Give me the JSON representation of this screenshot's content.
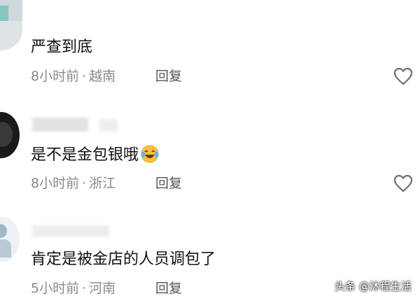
{
  "comments": [
    {
      "text": "严查到底",
      "time": "8小时前",
      "location": "越南",
      "reply": "回复"
    },
    {
      "text": "是不是金包银哦",
      "emoji": "laughing-tears-emoji",
      "time": "8小时前",
      "location": "浙江",
      "reply": "回复"
    },
    {
      "text": "肯定是被金店的人员调包了",
      "time": "5小时前",
      "location": "河南",
      "reply": "回复"
    }
  ],
  "separator": "·",
  "icons": {
    "like": "heart-outline-icon"
  },
  "watermark": "头条 @沐程生活",
  "colors": {
    "text": "#111111",
    "meta": "#8a8a8a",
    "reply": "#555555",
    "background": "#ffffff"
  }
}
